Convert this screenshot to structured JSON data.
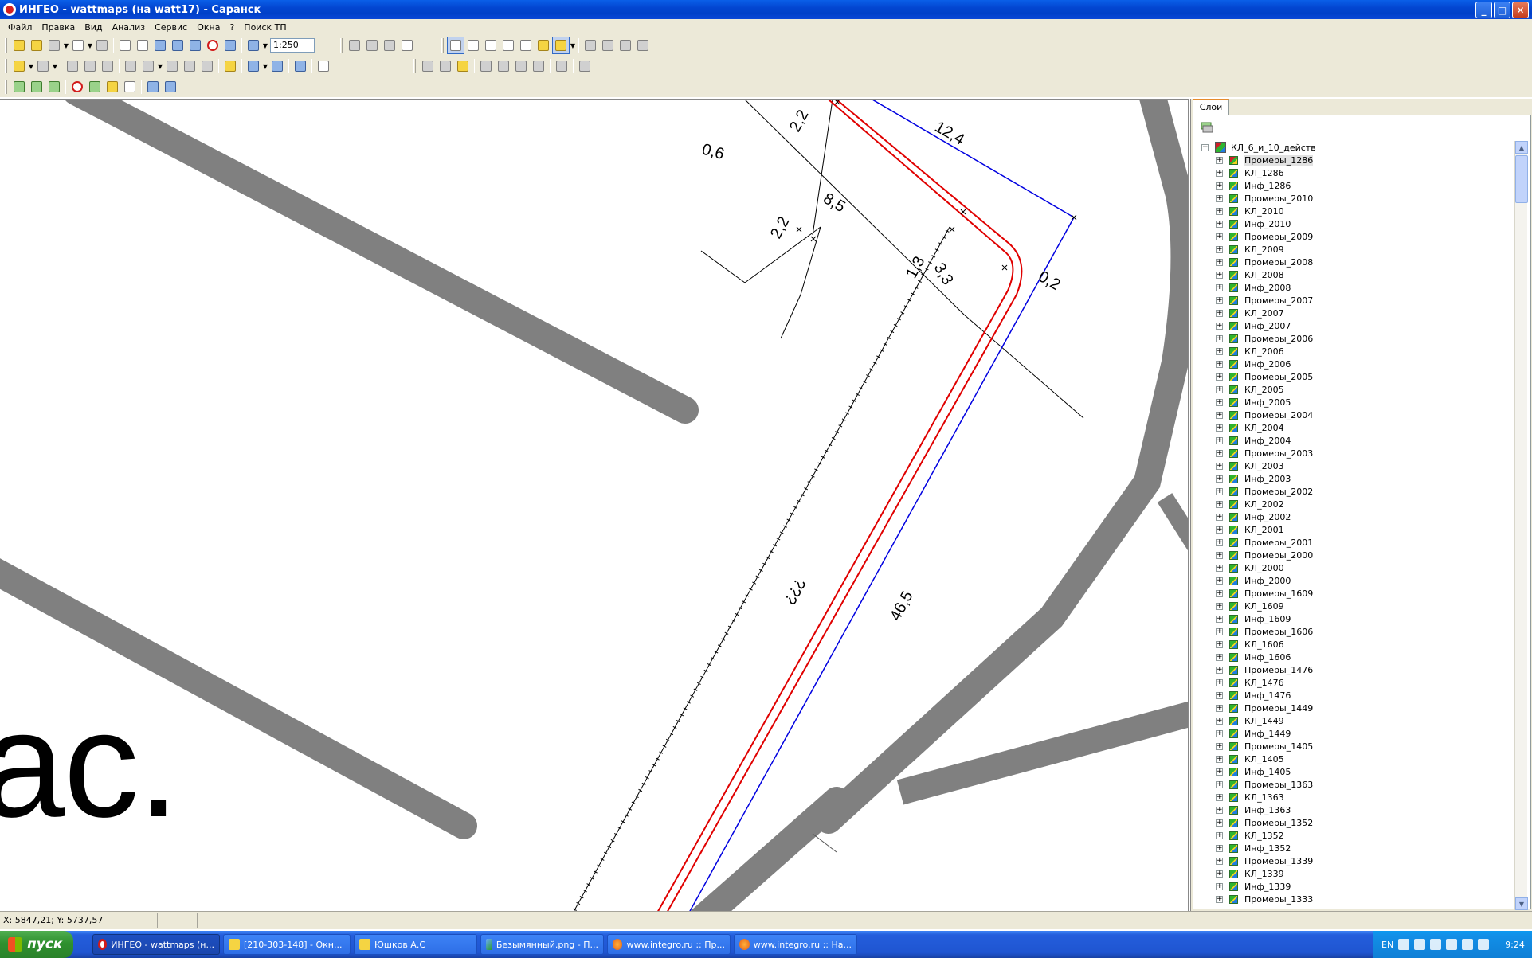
{
  "window": {
    "title": "ИНГЕО - wattmaps (на watt17) - Саранск",
    "buttons": {
      "minimize": "_",
      "maximize": "□",
      "close": "✕"
    }
  },
  "menu": [
    "Файл",
    "Правка",
    "Вид",
    "Анализ",
    "Сервис",
    "Окна",
    "?",
    "Поиск ТП"
  ],
  "toolbar": {
    "scale_value": "1:250"
  },
  "map": {
    "dimension_labels": [
      "2,2",
      "12,4",
      "0,6",
      "8,5",
      "2,2",
      "1,3",
      "3,3",
      "0,2",
      "???",
      "46,5"
    ],
    "big_text": "ас."
  },
  "layers_panel": {
    "tab_label": "Слои",
    "root_label": "КЛ_6_и_10_действ",
    "items": [
      "Промеры_1286",
      "КЛ_1286",
      "Инф_1286",
      "Промеры_2010",
      "КЛ_2010",
      "Инф_2010",
      "Промеры_2009",
      "КЛ_2009",
      "Промеры_2008",
      "КЛ_2008",
      "Инф_2008",
      "Промеры_2007",
      "КЛ_2007",
      "Инф_2007",
      "Промеры_2006",
      "КЛ_2006",
      "Инф_2006",
      "Промеры_2005",
      "КЛ_2005",
      "Инф_2005",
      "Промеры_2004",
      "КЛ_2004",
      "Инф_2004",
      "Промеры_2003",
      "КЛ_2003",
      "Инф_2003",
      "Промеры_2002",
      "КЛ_2002",
      "Инф_2002",
      "КЛ_2001",
      "Промеры_2001",
      "Промеры_2000",
      "КЛ_2000",
      "Инф_2000",
      "Промеры_1609",
      "КЛ_1609",
      "Инф_1609",
      "Промеры_1606",
      "КЛ_1606",
      "Инф_1606",
      "Промеры_1476",
      "КЛ_1476",
      "Инф_1476",
      "Промеры_1449",
      "КЛ_1449",
      "Инф_1449",
      "Промеры_1405",
      "КЛ_1405",
      "Инф_1405",
      "Промеры_1363",
      "КЛ_1363",
      "Инф_1363",
      "Промеры_1352",
      "КЛ_1352",
      "Инф_1352",
      "Промеры_1339",
      "КЛ_1339",
      "Инф_1339",
      "Промеры_1333"
    ]
  },
  "statusbar": {
    "coords": "X: 5847,21; Y: 5737,57"
  },
  "taskbar": {
    "start_label": "пуск",
    "tasks": [
      {
        "label": "ИНГЕО - wattmaps (н...",
        "icon": "ingeo-icon"
      },
      {
        "label": "[210-303-148] - Окн...",
        "icon": "window-icon"
      },
      {
        "label": "Юшков А.С",
        "icon": "folder-icon"
      },
      {
        "label": "Безымянный.png - П...",
        "icon": "paint-icon"
      },
      {
        "label": "www.integro.ru :: Пр...",
        "icon": "firefox-icon"
      },
      {
        "label": "www.integro.ru :: На...",
        "icon": "firefox-icon"
      }
    ],
    "tray": {
      "lang": "EN",
      "time": "9:24"
    }
  },
  "colors": {
    "road": "#808080",
    "cable_red": "#e00000",
    "line_blue": "#0000e0",
    "titlebar": "#0346d1"
  }
}
